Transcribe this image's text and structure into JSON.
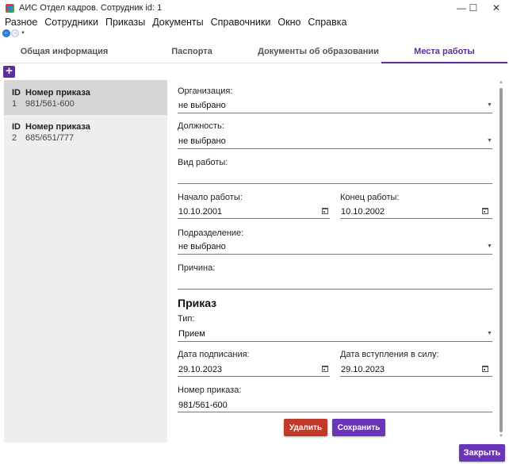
{
  "window": {
    "title": "АИС Отдел кадров. Сотрудник id: 1",
    "minimize": "—",
    "maximize": "☐",
    "close": "✕"
  },
  "menu": [
    "Разное",
    "Сотрудники",
    "Приказы",
    "Документы",
    "Справочники",
    "Окно",
    "Справка"
  ],
  "nav": {
    "back_glyph": "←",
    "forward_glyph": "→",
    "history_glyph": "▼"
  },
  "tabs": [
    {
      "label": "Общая информация",
      "active": false
    },
    {
      "label": "Паспорта",
      "active": false
    },
    {
      "label": "Документы об образовании",
      "active": false
    },
    {
      "label": "Места работы",
      "active": true
    }
  ],
  "add_button": {
    "glyph": "+"
  },
  "list": {
    "id_header": "ID",
    "order_header": "Номер приказа",
    "items": [
      {
        "id": "1",
        "order_no": "981/561-600",
        "selected": true
      },
      {
        "id": "2",
        "order_no": "685/651/777",
        "selected": false
      }
    ]
  },
  "form": {
    "organization": {
      "label": "Организация:",
      "value": "не выбрано"
    },
    "position": {
      "label": "Должность:",
      "value": "не выбрано"
    },
    "work_type": {
      "label": "Вид работы:",
      "value": ""
    },
    "start": {
      "label": "Начало работы:",
      "value": "10.10.2001"
    },
    "end": {
      "label": "Конец работы:",
      "value": "10.10.2002"
    },
    "department": {
      "label": "Подразделение:",
      "value": "не выбрано"
    },
    "reason": {
      "label": "Причина:",
      "value": ""
    },
    "order_section_title": "Приказ",
    "order_type": {
      "label": "Тип:",
      "value": "Прием"
    },
    "sign_date": {
      "label": "Дата подписания:",
      "value": "29.10.2023"
    },
    "effective_date": {
      "label": "Дата вступления в силу:",
      "value": "29.10.2023"
    },
    "order_number": {
      "label": "Номер приказа:",
      "value": "981/561-600"
    }
  },
  "buttons": {
    "delete": "Удалить",
    "save": "Сохранить",
    "close": "Закрыть"
  },
  "icons": {
    "dropdown": "▼",
    "scroll_up": "▲",
    "scroll_down": "▼"
  },
  "colors": {
    "accent": "#5b2d9e",
    "danger": "#c0392b",
    "button_primary": "#6a35b8"
  }
}
